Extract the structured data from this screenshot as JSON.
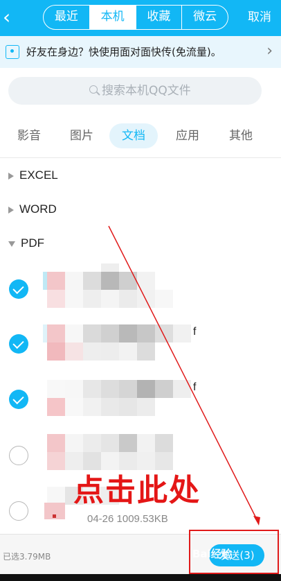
{
  "header": {
    "back_icon": "back-arrow-icon",
    "tabs": [
      {
        "label": "最近",
        "active": false
      },
      {
        "label": "本机",
        "active": true
      },
      {
        "label": "收藏",
        "active": false
      },
      {
        "label": "微云",
        "active": false
      }
    ],
    "cancel_label": "取消"
  },
  "banner": {
    "icon": "wifi-transfer-icon",
    "text": "好友在身边？快使用面对面快传(免流量)。",
    "arrow_icon": "chevron-right-icon"
  },
  "search": {
    "icon": "search-icon",
    "placeholder": "搜索本机QQ文件"
  },
  "categories": [
    {
      "label": "影音",
      "active": false
    },
    {
      "label": "图片",
      "active": false
    },
    {
      "label": "文档",
      "active": true
    },
    {
      "label": "应用",
      "active": false
    },
    {
      "label": "其他",
      "active": false
    }
  ],
  "folders": [
    {
      "label": "EXCEL",
      "expanded": false
    },
    {
      "label": "WORD",
      "expanded": false
    },
    {
      "label": "PDF",
      "expanded": true
    }
  ],
  "files": [
    {
      "checked": true,
      "suffix": ""
    },
    {
      "checked": true,
      "suffix": "f"
    },
    {
      "checked": true,
      "suffix": "f"
    },
    {
      "checked": false,
      "suffix": ""
    },
    {
      "checked": false,
      "suffix": "",
      "meta": "04-26   1009.53KB"
    }
  ],
  "bottom": {
    "selected_text": "已选3.79MB",
    "send_label": "发送(3)"
  },
  "annotation": {
    "text": "点击此处",
    "color": "#e41616"
  },
  "watermark": "Bai经验",
  "colors": {
    "accent": "#12b7f5",
    "annotation_red": "#e01a1a"
  }
}
